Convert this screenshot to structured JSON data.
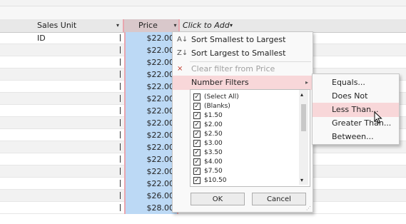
{
  "header": {
    "sales_unit_id": "Sales Unit ID",
    "price": "Price",
    "click_to_add": "Click to Add"
  },
  "rows": [
    {
      "price": "$22.00"
    },
    {
      "price": "$22.00"
    },
    {
      "price": "$22.00"
    },
    {
      "price": "$22.00"
    },
    {
      "price": "$22.00"
    },
    {
      "price": "$22.00"
    },
    {
      "price": "$22.00"
    },
    {
      "price": "$22.00"
    },
    {
      "price": "$22.00"
    },
    {
      "price": "$22.00"
    },
    {
      "price": "$22.00"
    },
    {
      "price": "$22.00"
    },
    {
      "price": "$22.00"
    },
    {
      "price": "$26.00"
    },
    {
      "price": "$28.00"
    }
  ],
  "filter_menu": {
    "sort_asc": "Sort Smallest to Largest",
    "sort_desc": "Sort Largest to Smallest",
    "clear_filter": "Clear filter from Price",
    "number_filters": "Number Filters",
    "values": [
      {
        "label": "(Select All)",
        "checked": true
      },
      {
        "label": "(Blanks)",
        "checked": true
      },
      {
        "label": "$1.50",
        "checked": true
      },
      {
        "label": "$2.00",
        "checked": true
      },
      {
        "label": "$2.50",
        "checked": true
      },
      {
        "label": "$3.00",
        "checked": true
      },
      {
        "label": "$3.50",
        "checked": true
      },
      {
        "label": "$4.00",
        "checked": true
      },
      {
        "label": "$7.50",
        "checked": true
      },
      {
        "label": "$10.50",
        "checked": true
      }
    ],
    "ok": "OK",
    "cancel": "Cancel"
  },
  "number_filters_submenu": {
    "items": [
      "Equals...",
      "Does Not Equal...",
      "Less Than...",
      "Greater Than...",
      "Between..."
    ],
    "highlighted": "Less Than..."
  },
  "colors": {
    "price_fill": "#bcd9f5",
    "highlight": "#f8d7d9",
    "column_border": "#e9a6ae"
  }
}
